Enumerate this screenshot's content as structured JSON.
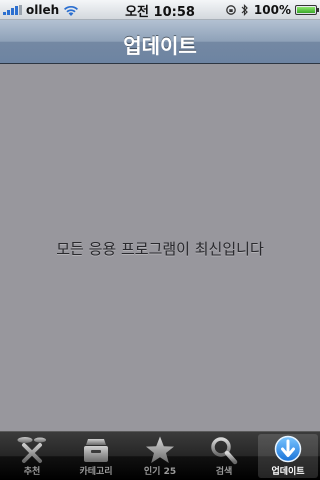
{
  "status_bar": {
    "carrier": "olleh",
    "time": "오전 10:58",
    "battery_percent": "100%",
    "battery_level": 1.0,
    "signal_bars": 4,
    "icons": [
      "signal-icon",
      "wifi-icon",
      "lock-rotation-icon",
      "bluetooth-icon",
      "battery-icon"
    ]
  },
  "nav": {
    "title": "업데이트"
  },
  "content": {
    "empty_message": "모든 응용 프로그램이 최신입니다"
  },
  "tab_bar": {
    "selected": "updates",
    "tabs": [
      {
        "id": "featured",
        "label": "추천",
        "icon": "featured-icon"
      },
      {
        "id": "categories",
        "label": "카테고리",
        "icon": "categories-icon"
      },
      {
        "id": "top25",
        "label": "인기 25",
        "icon": "star-icon"
      },
      {
        "id": "search",
        "label": "검색",
        "icon": "search-icon"
      },
      {
        "id": "updates",
        "label": "업데이트",
        "icon": "updates-icon"
      }
    ]
  },
  "colors": {
    "nav_bar": "#7d91ab",
    "content_bg": "#98979d",
    "tab_bar": "#111111",
    "update_icon_accent": "#2f8fe8"
  }
}
